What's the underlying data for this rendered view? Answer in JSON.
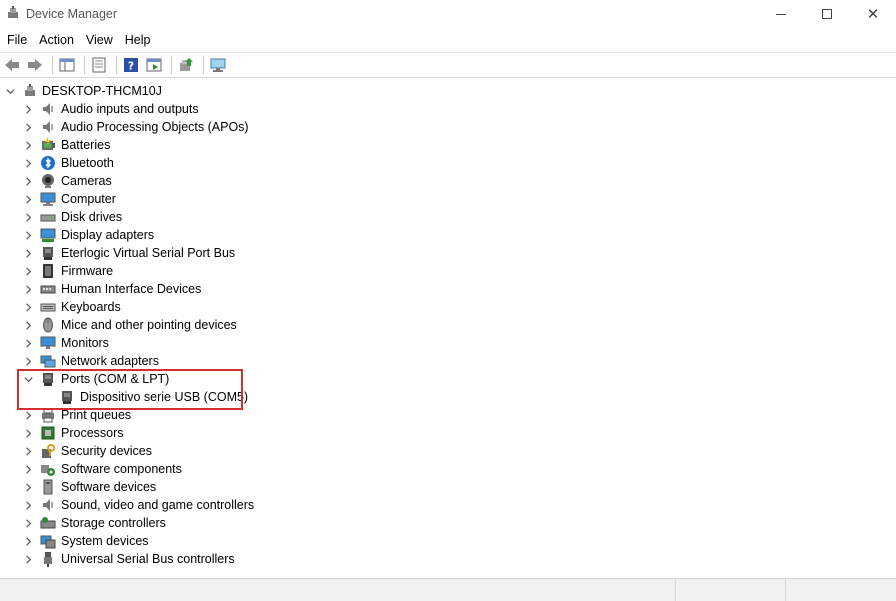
{
  "window": {
    "title": "Device Manager"
  },
  "menu": [
    "File",
    "Action",
    "View",
    "Help"
  ],
  "toolbar": {
    "buttons": [
      {
        "name": "back-arrow-icon"
      },
      {
        "name": "forward-arrow-icon"
      },
      {
        "name": "show-hide-console-tree-icon"
      },
      {
        "name": "properties-icon"
      },
      {
        "name": "help-icon"
      },
      {
        "name": "action-pane-icon"
      },
      {
        "name": "update-driver-icon"
      },
      {
        "name": "scan-hardware-icon"
      }
    ]
  },
  "tree": {
    "root": "DESKTOP-THCM10J",
    "categories": [
      {
        "label": "Audio inputs and outputs",
        "icon": "speaker-icon"
      },
      {
        "label": "Audio Processing Objects (APOs)",
        "icon": "speaker-icon"
      },
      {
        "label": "Batteries",
        "icon": "battery-icon"
      },
      {
        "label": "Bluetooth",
        "icon": "bluetooth-icon"
      },
      {
        "label": "Cameras",
        "icon": "camera-icon"
      },
      {
        "label": "Computer",
        "icon": "computer-icon"
      },
      {
        "label": "Disk drives",
        "icon": "disk-drive-icon"
      },
      {
        "label": "Display adapters",
        "icon": "display-adapter-icon"
      },
      {
        "label": "Eterlogic Virtual Serial Port Bus",
        "icon": "port-icon"
      },
      {
        "label": "Firmware",
        "icon": "firmware-icon"
      },
      {
        "label": "Human Interface Devices",
        "icon": "hid-icon"
      },
      {
        "label": "Keyboards",
        "icon": "keyboard-icon"
      },
      {
        "label": "Mice and other pointing devices",
        "icon": "mouse-icon"
      },
      {
        "label": "Monitors",
        "icon": "monitor-icon"
      },
      {
        "label": "Network adapters",
        "icon": "network-icon"
      },
      {
        "label": "Ports (COM & LPT)",
        "icon": "port-icon",
        "expanded": true,
        "children": [
          "Dispositivo serie USB (COM5)"
        ]
      },
      {
        "label": "Print queues",
        "icon": "printer-icon"
      },
      {
        "label": "Processors",
        "icon": "processor-icon"
      },
      {
        "label": "Security devices",
        "icon": "security-icon"
      },
      {
        "label": "Software components",
        "icon": "software-component-icon"
      },
      {
        "label": "Software devices",
        "icon": "software-device-icon"
      },
      {
        "label": "Sound, video and game controllers",
        "icon": "speaker-icon"
      },
      {
        "label": "Storage controllers",
        "icon": "storage-controller-icon"
      },
      {
        "label": "System devices",
        "icon": "system-device-icon"
      },
      {
        "label": "Universal Serial Bus controllers",
        "icon": "usb-icon"
      }
    ]
  },
  "colors": {
    "highlight": "#d32f2f",
    "accent": "#0078d4"
  }
}
